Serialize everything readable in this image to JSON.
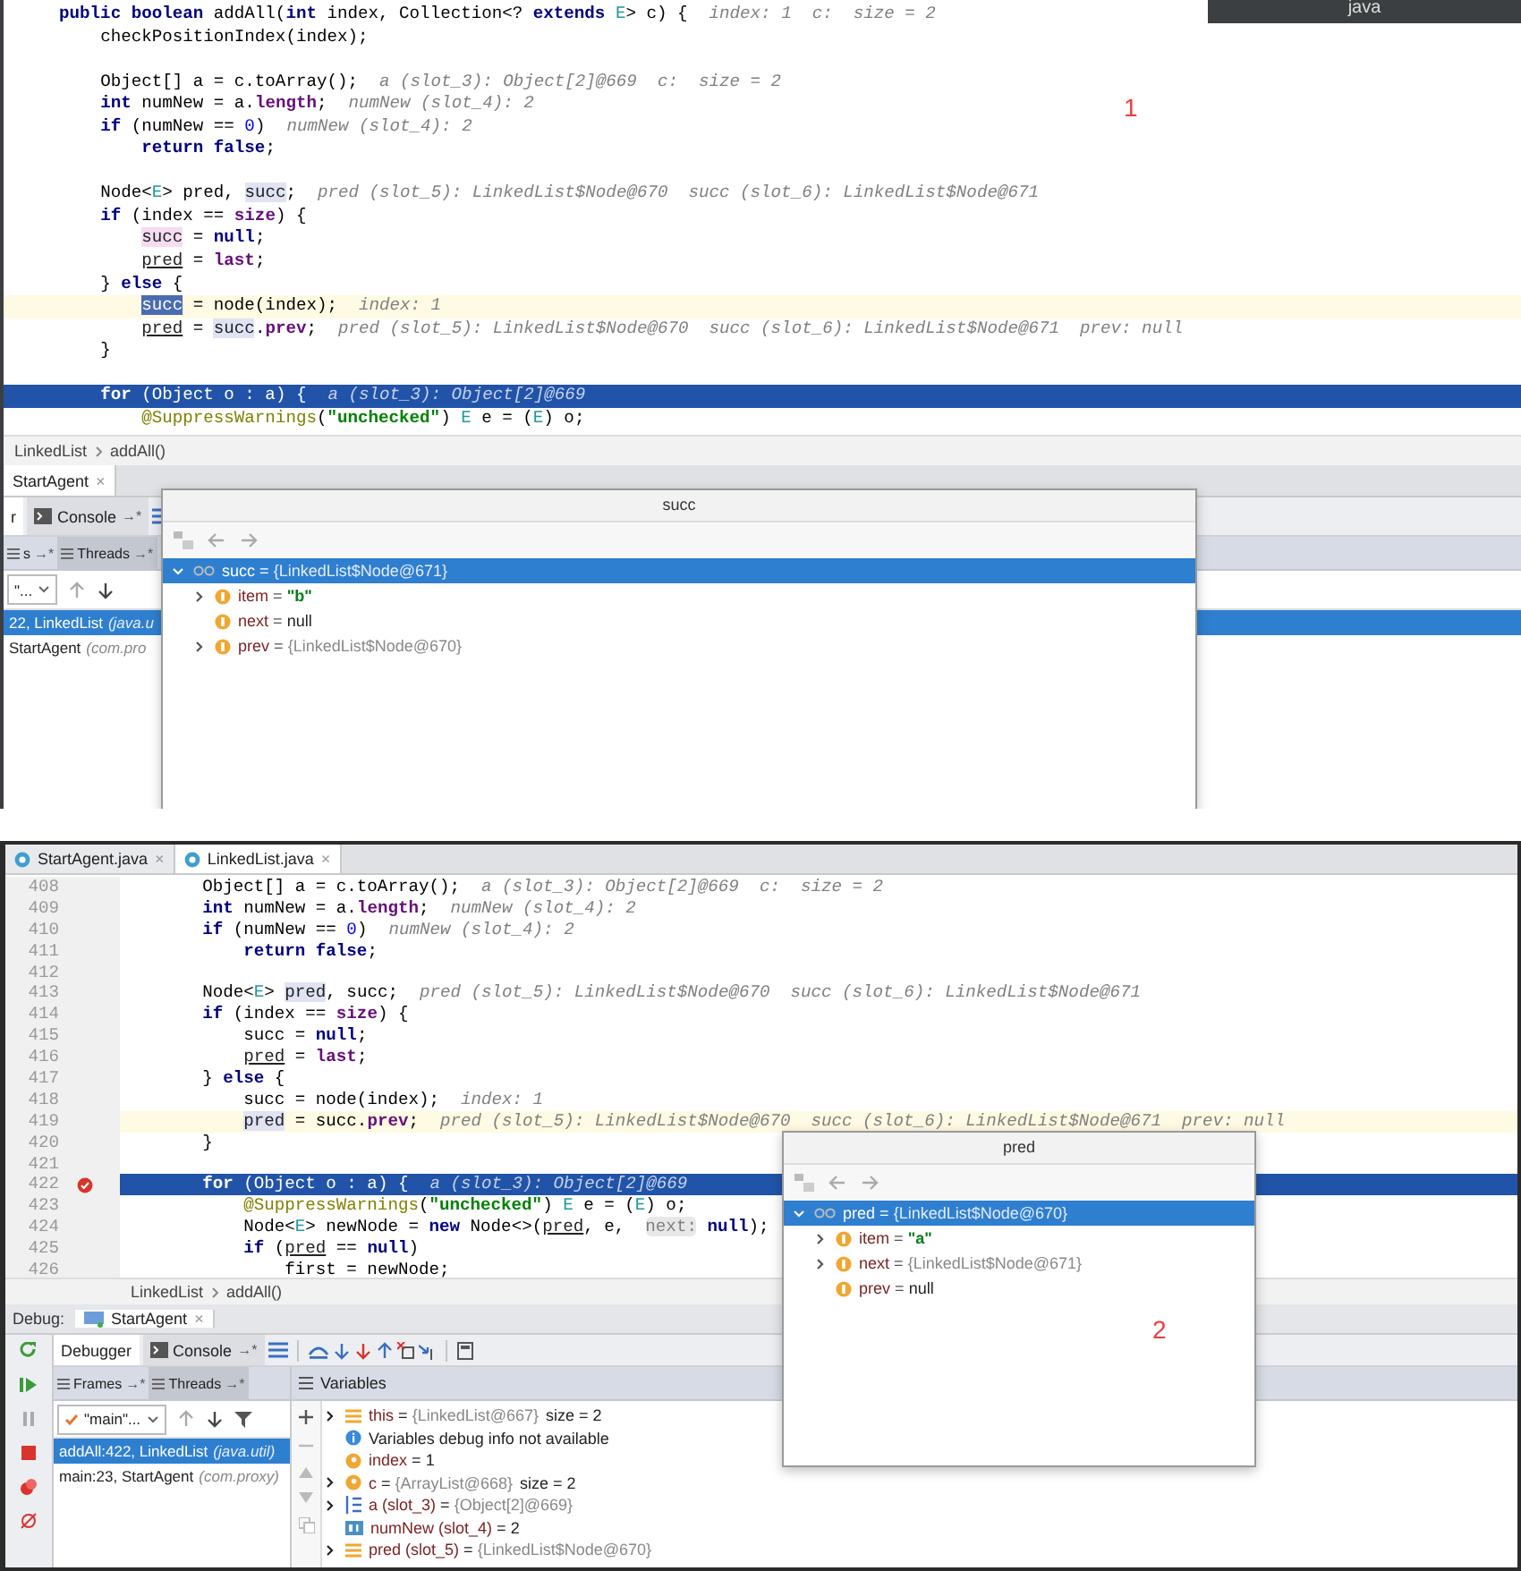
{
  "top_screenshot": {
    "corner_tab": "java",
    "annotation": "1",
    "code_lines": [
      {
        "tokens": [
          {
            "t": "    public boolean ",
            "kind": "kw"
          },
          {
            "t": "addAll(",
            "kind": "plain"
          },
          {
            "t": "int",
            "kind": "kw"
          },
          {
            "t": " index, Collection<? ",
            "kind": "plain"
          },
          {
            "t": "extends ",
            "kind": "kw"
          },
          {
            "t": "E",
            "kind": "type"
          },
          {
            "t": "> c) {",
            "kind": "plain"
          }
        ],
        "hint": "index: 1  c:  size = 2",
        "current": false,
        "caret": false
      },
      {
        "tokens": [
          {
            "t": "        checkPositionIndex(index);",
            "kind": "plain"
          }
        ],
        "current": false,
        "caret": false
      },
      {
        "current": false,
        "caret": false
      },
      {
        "tokens": [
          {
            "t": "        Object[] a = c.toArray();",
            "kind": "plain"
          }
        ],
        "hint": "a (slot_3): Object[2]@669  c:  size = 2",
        "current": false,
        "caret": false
      },
      {
        "tokens": [
          {
            "t": "        int",
            "kind": "kw"
          },
          {
            "t": " numNew = a.",
            "kind": "plain"
          },
          {
            "t": "length",
            "kind": "field"
          },
          {
            "t": ";",
            "kind": "plain"
          }
        ],
        "hint": "numNew (slot_4): 2",
        "current": false,
        "caret": false
      },
      {
        "tokens": [
          {
            "t": "        if",
            "kind": "kw"
          },
          {
            "t": " (numNew == ",
            "kind": "plain"
          },
          {
            "t": "0",
            "kind": "num"
          },
          {
            "t": ")",
            "kind": "plain"
          }
        ],
        "hint": "numNew (slot_4): 2",
        "current": false,
        "caret": false
      },
      {
        "tokens": [
          {
            "t": "            return false",
            "kind": "kw"
          },
          {
            "t": ";",
            "kind": "plain"
          }
        ],
        "current": false,
        "caret": false
      },
      {
        "current": false,
        "caret": false
      },
      {
        "tokens": [
          {
            "t": "        Node<",
            "kind": "plain"
          },
          {
            "t": "E",
            "kind": "type"
          },
          {
            "t": "> pred, ",
            "kind": "plain"
          },
          {
            "t": "succ",
            "kind": "hlr"
          },
          {
            "t": ";",
            "kind": "plain"
          }
        ],
        "hint": "pred (slot_5): LinkedList$Node@670  succ (slot_6): LinkedList$Node@671",
        "current": false,
        "caret": false
      },
      {
        "tokens": [
          {
            "t": "        if",
            "kind": "kw"
          },
          {
            "t": " (index == ",
            "kind": "plain"
          },
          {
            "t": "size",
            "kind": "field"
          },
          {
            "t": ") {",
            "kind": "plain"
          }
        ],
        "current": false,
        "caret": false
      },
      {
        "tokens": [
          {
            "t": "            succ",
            "kind": "hlw"
          },
          {
            "t": " = ",
            "kind": "plain"
          },
          {
            "t": "null",
            "kind": "kw"
          },
          {
            "t": ";",
            "kind": "plain"
          }
        ],
        "current": false,
        "caret": false
      },
      {
        "tokens": [
          {
            "t": "            pred",
            "kind": "under"
          },
          {
            "t": " = ",
            "kind": "plain"
          },
          {
            "t": "last",
            "kind": "field"
          },
          {
            "t": ";",
            "kind": "plain"
          }
        ],
        "current": false,
        "caret": false
      },
      {
        "tokens": [
          {
            "t": "        } ",
            "kind": "plain"
          },
          {
            "t": "else",
            "kind": "kw"
          },
          {
            "t": " {",
            "kind": "plain"
          }
        ],
        "current": false,
        "caret": false
      },
      {
        "tokens": [
          {
            "t": "            succ",
            "kind": "sel"
          },
          {
            "t": " = node(index);",
            "kind": "plain"
          }
        ],
        "hint": "index: 1",
        "current": false,
        "caret": true
      },
      {
        "tokens": [
          {
            "t": "            pred",
            "kind": "under"
          },
          {
            "t": " = ",
            "kind": "plain"
          },
          {
            "t": "succ",
            "kind": "hlr"
          },
          {
            "t": ".",
            "kind": "plain"
          },
          {
            "t": "prev",
            "kind": "field"
          },
          {
            "t": ";",
            "kind": "plain"
          }
        ],
        "hint": "pred (slot_5): LinkedList$Node@670  succ (slot_6): LinkedList$Node@671  prev: null",
        "current": false,
        "caret": false
      },
      {
        "tokens": [
          {
            "t": "        }",
            "kind": "plain"
          }
        ],
        "current": false,
        "caret": false
      },
      {
        "current": false,
        "caret": false
      },
      {
        "tokens": [
          {
            "t": "        for",
            "kind": "kw"
          },
          {
            "t": " (Object o : a) {",
            "kind": "plain"
          }
        ],
        "hint": "a (slot_3): Object[2]@669",
        "current": true,
        "caret": false
      },
      {
        "tokens": [
          {
            "t": "            @SuppressWarnings",
            "kind": "ann"
          },
          {
            "t": "(",
            "kind": "plain"
          },
          {
            "t": "\"unchecked\"",
            "kind": "str"
          },
          {
            "t": ") ",
            "kind": "plain"
          },
          {
            "t": "E",
            "kind": "type"
          },
          {
            "t": " e = (",
            "kind": "plain"
          },
          {
            "t": "E",
            "kind": "type"
          },
          {
            "t": ") o;",
            "kind": "plain"
          }
        ],
        "current": false,
        "caret": false
      }
    ],
    "breadcrumb": [
      "LinkedList",
      "addAll()"
    ],
    "session_tab": {
      "label": "StartAgent",
      "close": "×"
    },
    "debugger_tabs": [
      {
        "kind": "debugger",
        "label": "r",
        "selected": true
      },
      {
        "kind": "console",
        "label": "Console",
        "pin": "→*",
        "selected": false
      }
    ],
    "pane_tabs": [
      {
        "label": "s",
        "pin": "→*",
        "selected": false
      },
      {
        "label": "Threads",
        "pin": "→*",
        "selected": true
      }
    ],
    "thread_selector": "\"...",
    "frames": [
      {
        "method": "22, LinkedList",
        "package": "(java.u",
        "selected": true
      },
      {
        "method": "StartAgent",
        "package": "(com.pro",
        "selected": false
      }
    ],
    "popup": {
      "title": "succ",
      "tree": [
        {
          "name": "succ",
          "op": "=",
          "value": "{LinkedList$Node@671}",
          "reference": true,
          "string": false,
          "selected": true,
          "expandable": true,
          "expanded": true,
          "children": [
            {
              "name": "item",
              "op": "=",
              "value": "\"b\"",
              "reference": false,
              "string": true,
              "selected": false,
              "expandable": true,
              "expanded": false
            },
            {
              "name": "next",
              "op": "=",
              "value": "null",
              "reference": false,
              "string": false,
              "selected": false,
              "expandable": false
            },
            {
              "name": "prev",
              "op": "=",
              "value": "{LinkedList$Node@670}",
              "reference": true,
              "string": false,
              "selected": false,
              "expandable": true,
              "expanded": false
            }
          ]
        }
      ]
    }
  },
  "bottom_screenshot": {
    "editor_tabs": [
      {
        "label": "StartAgent.java",
        "close": "×",
        "selected": false
      },
      {
        "label": "LinkedList.java",
        "close": "×",
        "selected": true
      }
    ],
    "code_lines": [
      {
        "number": "408",
        "tokens": [
          {
            "t": "        Object[] a = c.toArray();",
            "kind": "plain"
          }
        ],
        "hint": "a (slot_3): Object[2]@669  c:  size = 2",
        "current": false,
        "caret": false,
        "breakpoint": false
      },
      {
        "number": "409",
        "tokens": [
          {
            "t": "        int",
            "kind": "kw"
          },
          {
            "t": " numNew = a.",
            "kind": "plain"
          },
          {
            "t": "length",
            "kind": "field"
          },
          {
            "t": ";",
            "kind": "plain"
          }
        ],
        "hint": "numNew (slot_4): 2",
        "current": false,
        "caret": false,
        "breakpoint": false
      },
      {
        "number": "410",
        "tokens": [
          {
            "t": "        if",
            "kind": "kw"
          },
          {
            "t": " (numNew == ",
            "kind": "plain"
          },
          {
            "t": "0",
            "kind": "num"
          },
          {
            "t": ")",
            "kind": "plain"
          }
        ],
        "hint": "numNew (slot_4): 2",
        "current": false,
        "caret": false,
        "breakpoint": false
      },
      {
        "number": "411",
        "tokens": [
          {
            "t": "            return false",
            "kind": "kw"
          },
          {
            "t": ";",
            "kind": "plain"
          }
        ],
        "current": false,
        "caret": false,
        "breakpoint": false
      },
      {
        "number": "412",
        "current": false,
        "caret": false,
        "breakpoint": false
      },
      {
        "number": "413",
        "tokens": [
          {
            "t": "        Node<",
            "kind": "plain"
          },
          {
            "t": "E",
            "kind": "type"
          },
          {
            "t": "> ",
            "kind": "plain"
          },
          {
            "t": "pred",
            "kind": "hlr"
          },
          {
            "t": ", succ;",
            "kind": "plain"
          }
        ],
        "hint": "pred (slot_5): LinkedList$Node@670  succ (slot_6): LinkedList$Node@671",
        "current": false,
        "caret": false,
        "breakpoint": false
      },
      {
        "number": "414",
        "tokens": [
          {
            "t": "        if",
            "kind": "kw"
          },
          {
            "t": " (index == ",
            "kind": "plain"
          },
          {
            "t": "size",
            "kind": "field"
          },
          {
            "t": ") {",
            "kind": "plain"
          }
        ],
        "current": false,
        "caret": false,
        "breakpoint": false
      },
      {
        "number": "415",
        "tokens": [
          {
            "t": "            succ = ",
            "kind": "plain"
          },
          {
            "t": "null",
            "kind": "kw"
          },
          {
            "t": ";",
            "kind": "plain"
          }
        ],
        "current": false,
        "caret": false,
        "breakpoint": false
      },
      {
        "number": "416",
        "tokens": [
          {
            "t": "            pred",
            "kind": "under"
          },
          {
            "t": " = ",
            "kind": "plain"
          },
          {
            "t": "last",
            "kind": "field"
          },
          {
            "t": ";",
            "kind": "plain"
          }
        ],
        "current": false,
        "caret": false,
        "breakpoint": false
      },
      {
        "number": "417",
        "tokens": [
          {
            "t": "        } ",
            "kind": "plain"
          },
          {
            "t": "else",
            "kind": "kw"
          },
          {
            "t": " {",
            "kind": "plain"
          }
        ],
        "current": false,
        "caret": false,
        "breakpoint": false
      },
      {
        "number": "418",
        "tokens": [
          {
            "t": "            succ = node(index);",
            "kind": "plain"
          }
        ],
        "hint": "index: 1",
        "current": false,
        "caret": false,
        "breakpoint": false
      },
      {
        "number": "419",
        "tokens": [
          {
            "t": "            pred",
            "kind": "hlr"
          },
          {
            "t": " = succ.",
            "kind": "plain"
          },
          {
            "t": "prev",
            "kind": "field"
          },
          {
            "t": ";",
            "kind": "plain"
          }
        ],
        "hint": "pred (slot_5): LinkedList$Node@670  succ (slot_6): LinkedList$Node@671  prev: null",
        "current": false,
        "caret": true,
        "breakpoint": false
      },
      {
        "number": "420",
        "tokens": [
          {
            "t": "        }",
            "kind": "plain"
          }
        ],
        "current": false,
        "caret": false,
        "breakpoint": false
      },
      {
        "number": "421",
        "current": false,
        "caret": false,
        "breakpoint": false
      },
      {
        "number": "422",
        "tokens": [
          {
            "t": "        for",
            "kind": "kw"
          },
          {
            "t": " (Object o : a) {",
            "kind": "plain"
          }
        ],
        "hint": "a (slot_3): Object[2]@669",
        "current": true,
        "caret": false,
        "breakpoint": true
      },
      {
        "number": "423",
        "tokens": [
          {
            "t": "            @SuppressWarnings",
            "kind": "ann"
          },
          {
            "t": "(",
            "kind": "plain"
          },
          {
            "t": "\"unchecked\"",
            "kind": "str"
          },
          {
            "t": ") ",
            "kind": "plain"
          },
          {
            "t": "E",
            "kind": "type"
          },
          {
            "t": " e = (",
            "kind": "plain"
          },
          {
            "t": "E",
            "kind": "type"
          },
          {
            "t": ") o;",
            "kind": "plain"
          }
        ],
        "current": false,
        "caret": false,
        "breakpoint": false
      },
      {
        "number": "424",
        "tokens": [
          {
            "t": "            Node<",
            "kind": "plain"
          },
          {
            "t": "E",
            "kind": "type"
          },
          {
            "t": "> newNode = ",
            "kind": "plain"
          },
          {
            "t": "new",
            "kind": "kw"
          },
          {
            "t": " Node<>(",
            "kind": "plain"
          },
          {
            "t": "pred",
            "kind": "under"
          },
          {
            "t": ", e,  ",
            "kind": "plain"
          },
          {
            "t": "next:",
            "kind": "param"
          },
          {
            "t": " null",
            "kind": "kw"
          },
          {
            "t": ");",
            "kind": "plain"
          }
        ],
        "current": false,
        "caret": false,
        "breakpoint": false
      },
      {
        "number": "425",
        "tokens": [
          {
            "t": "            if",
            "kind": "kw"
          },
          {
            "t": " (",
            "kind": "plain"
          },
          {
            "t": "pred",
            "kind": "under"
          },
          {
            "t": " == ",
            "kind": "plain"
          },
          {
            "t": "null",
            "kind": "kw"
          },
          {
            "t": ")",
            "kind": "plain"
          }
        ],
        "current": false,
        "caret": false,
        "breakpoint": false
      },
      {
        "number": "426",
        "tokens": [
          {
            "t": "                first = newNode;",
            "kind": "plain"
          }
        ],
        "current": false,
        "caret": false,
        "breakpoint": false
      }
    ],
    "breadcrumb": [
      "LinkedList",
      "addAll()"
    ],
    "debug_label": "Debug:",
    "session_tab": {
      "label": "StartAgent",
      "close": "×"
    },
    "debugger_tabs": [
      {
        "kind": "debugger",
        "label": "Debugger",
        "selected": true
      },
      {
        "kind": "console",
        "label": "Console",
        "pin": "→*",
        "selected": false
      }
    ],
    "pane_tabs": [
      {
        "label": "Frames",
        "pin": "→*",
        "selected": false
      },
      {
        "label": "Threads",
        "pin": "→*",
        "selected": true
      }
    ],
    "variables_title": "Variables",
    "thread_selector": "\"main\"...",
    "frames": [
      {
        "method": "addAll:422, LinkedList",
        "package": "(java.util)",
        "selected": true
      },
      {
        "method": "main:23, StartAgent",
        "package": "(com.proxy)",
        "selected": false
      }
    ],
    "variables": [
      {
        "kind": "object",
        "name": "this",
        "op": "=",
        "value": "{LinkedList@667}",
        "extra": "size = 2",
        "reference": true,
        "expandable": true
      },
      {
        "kind": "info",
        "name": "Variables debug info not available",
        "expandable": false
      },
      {
        "kind": "param",
        "name": "index",
        "op": "=",
        "value": "1",
        "reference": false,
        "expandable": false
      },
      {
        "kind": "param",
        "name": "c",
        "op": "=",
        "value": "{ArrayList@668}",
        "extra": "size = 2",
        "reference": true,
        "expandable": true
      },
      {
        "kind": "array",
        "name": "a (slot_3)",
        "op": "=",
        "value": "{Object[2]@669}",
        "reference": true,
        "expandable": true
      },
      {
        "kind": "primitive",
        "name": "numNew (slot_4)",
        "op": "=",
        "value": "2",
        "reference": false,
        "expandable": false
      },
      {
        "kind": "object",
        "name": "pred (slot_5)",
        "op": "=",
        "value": "{LinkedList$Node@670}",
        "reference": true,
        "expandable": true
      }
    ],
    "popup": {
      "title": "pred",
      "annotation": "2",
      "tree": [
        {
          "name": "pred",
          "op": "=",
          "value": "{LinkedList$Node@670}",
          "reference": true,
          "string": false,
          "selected": true,
          "expandable": true,
          "expanded": true,
          "children": [
            {
              "name": "item",
              "op": "=",
              "value": "\"a\"",
              "reference": false,
              "string": true,
              "selected": false,
              "expandable": true,
              "expanded": false
            },
            {
              "name": "next",
              "op": "=",
              "value": "{LinkedList$Node@671}",
              "reference": true,
              "string": false,
              "selected": false,
              "expandable": true,
              "expanded": false
            },
            {
              "name": "prev",
              "op": "=",
              "value": "null",
              "reference": false,
              "string": false,
              "selected": false,
              "expandable": false
            }
          ]
        }
      ]
    }
  }
}
